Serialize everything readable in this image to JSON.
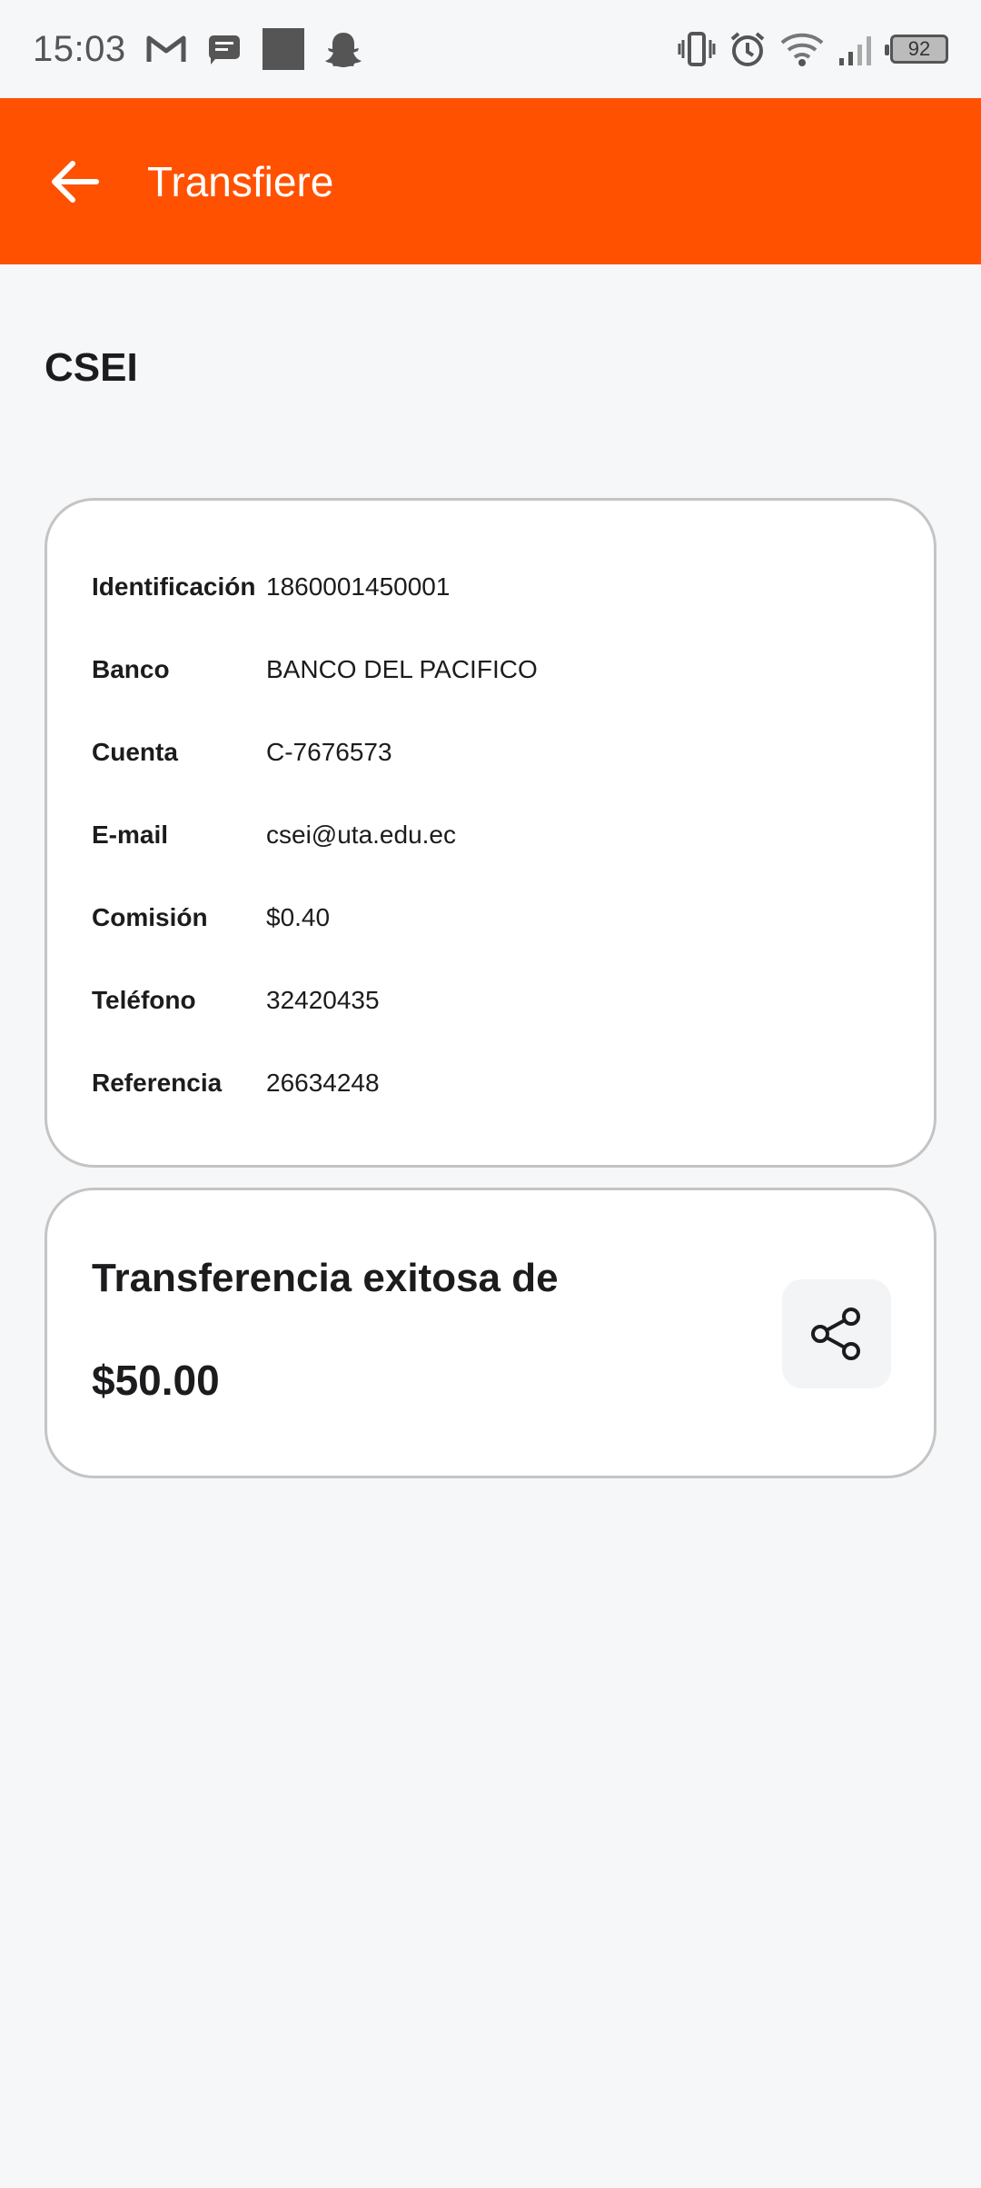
{
  "status_bar": {
    "time": "15:03",
    "battery": "92",
    "left_icons": [
      "gmail-icon",
      "messages-icon",
      "app-square-icon",
      "snapchat-icon"
    ],
    "right_icons": [
      "vibrate-icon",
      "alarm-icon",
      "wifi-icon",
      "signal-icon",
      "battery-icon"
    ]
  },
  "appbar": {
    "title": "Transfiere",
    "color": "#ff5100"
  },
  "page": {
    "title": "CSEI"
  },
  "details": [
    {
      "label": "Identificación",
      "value": "1860001450001"
    },
    {
      "label": "Banco",
      "value": "BANCO DEL PACIFICO"
    },
    {
      "label": "Cuenta",
      "value": "C-7676573"
    },
    {
      "label": "E-mail",
      "value": "csei@uta.edu.ec"
    },
    {
      "label": "Comisión",
      "value": "$0.40"
    },
    {
      "label": "Teléfono",
      "value": "32420435"
    },
    {
      "label": "Referencia",
      "value": "26634248"
    }
  ],
  "success": {
    "title": "Transferencia exitosa de",
    "amount": "$50.00"
  }
}
